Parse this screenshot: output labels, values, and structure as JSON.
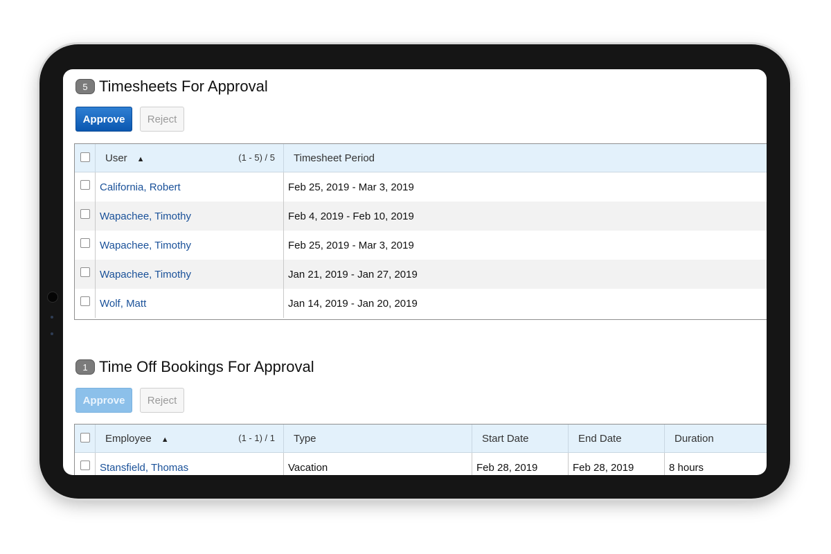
{
  "timesheets": {
    "count": "5",
    "title": "Timesheets For Approval",
    "approve_label": "Approve",
    "reject_label": "Reject",
    "columns": {
      "user": "User",
      "pager": "(1 - 5) / 5",
      "period": "Timesheet Period"
    },
    "rows": [
      {
        "user": "California, Robert",
        "period": "Feb 25, 2019 - Mar 3, 2019"
      },
      {
        "user": "Wapachee, Timothy",
        "period": "Feb 4, 2019 - Feb 10, 2019"
      },
      {
        "user": "Wapachee, Timothy",
        "period": "Feb 25, 2019 - Mar 3, 2019"
      },
      {
        "user": "Wapachee, Timothy",
        "period": "Jan 21, 2019 - Jan 27, 2019"
      },
      {
        "user": "Wolf, Matt",
        "period": "Jan 14, 2019 - Jan 20, 2019"
      }
    ]
  },
  "timeoff": {
    "count": "1",
    "title": "Time Off Bookings For Approval",
    "approve_label": "Approve",
    "reject_label": "Reject",
    "columns": {
      "employee": "Employee",
      "pager": "(1 - 1) / 1",
      "type": "Type",
      "start": "Start Date",
      "end": "End Date",
      "duration": "Duration"
    },
    "rows": [
      {
        "employee": "Stansfield, Thomas",
        "type": "Vacation",
        "start": "Feb 28, 2019",
        "end": "Feb 28, 2019",
        "duration": "8 hours"
      }
    ]
  },
  "colors": {
    "accent": "#0a57b0",
    "header_bg": "#e3f1fb",
    "link": "#1a5199"
  }
}
